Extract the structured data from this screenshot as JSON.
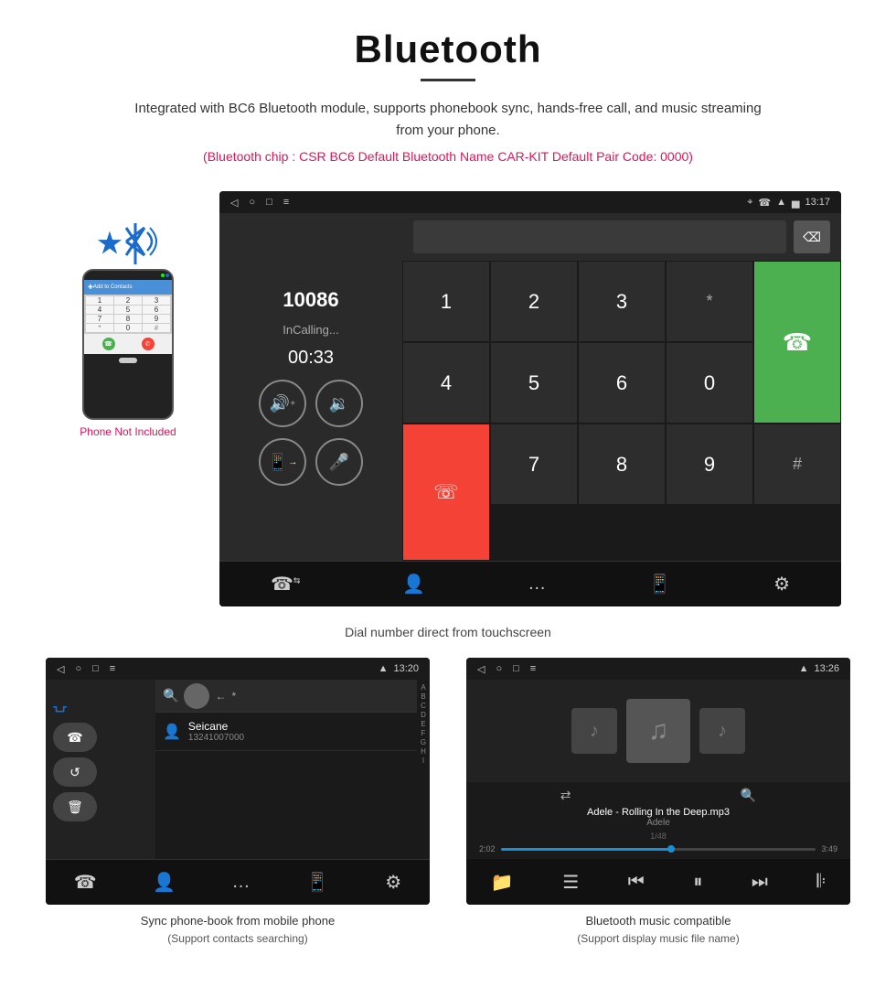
{
  "header": {
    "title": "Bluetooth",
    "description": "Integrated with BC6 Bluetooth module, supports phonebook sync, hands-free call, and music streaming from your phone.",
    "specs": "(Bluetooth chip : CSR BC6    Default Bluetooth Name CAR-KIT    Default Pair Code: 0000)"
  },
  "call_screen": {
    "status_time": "13:17",
    "call_number": "10086",
    "call_status": "InCalling...",
    "call_timer": "00:33",
    "keypad_keys": [
      "1",
      "2",
      "3",
      "*",
      "4",
      "5",
      "6",
      "0",
      "7",
      "8",
      "9",
      "#"
    ],
    "phone_icon": "📞",
    "caption": "Dial number direct from touchscreen"
  },
  "phonebook_screen": {
    "status_time": "13:20",
    "contact_name": "Seicane",
    "contact_number": "13241007000",
    "alpha_list": [
      "A",
      "B",
      "C",
      "D",
      "E",
      "F",
      "G",
      "H",
      "I"
    ],
    "caption": "Sync phone-book from mobile phone",
    "caption_sub": "(Support contacts searching)"
  },
  "music_screen": {
    "status_time": "13:26",
    "track_name": "Adele - Rolling In the Deep.mp3",
    "artist_name": "Adele",
    "track_num": "1/48",
    "time_current": "2:02",
    "time_total": "3:49",
    "progress_pct": 54,
    "caption": "Bluetooth music compatible",
    "caption_sub": "(Support display music file name)"
  },
  "phone_illustration": {
    "contact_label": "Add to Contacts",
    "not_included": "Phone Not Included",
    "keys": [
      "1",
      "2",
      "3",
      "4",
      "5",
      "6",
      "*",
      "0",
      "#"
    ]
  },
  "icons": {
    "bluetooth": "Ƀ",
    "back_arrow": "◁",
    "circle": "○",
    "square": "□",
    "settings": "⚙",
    "person": "👤",
    "grid": "⊞",
    "phone_up": "📞",
    "phone_down": "📵",
    "volume_up": "🔊",
    "volume_down": "🔉",
    "transfer": "📤",
    "mic": "🎤",
    "search": "🔍",
    "music_note": "♪",
    "shuffle": "⇄",
    "prev": "⏮",
    "play": "⏸",
    "next": "⏭",
    "eq": "≡",
    "folder": "📁",
    "list": "☰",
    "trash": "🗑",
    "sync": "↻"
  }
}
